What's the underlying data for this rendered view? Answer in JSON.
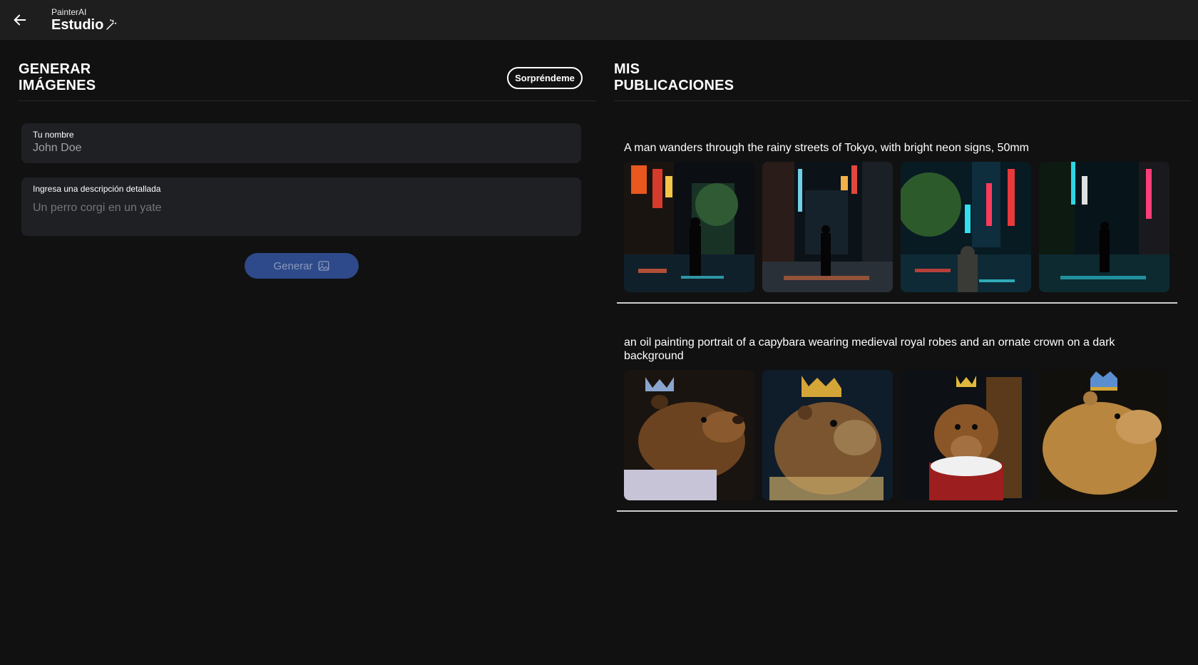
{
  "header": {
    "brand_sub": "PainterAI",
    "brand_title": "Estudio",
    "back_icon": "arrow-left-icon",
    "wand_icon": "magic-wand-icon"
  },
  "generate": {
    "title": "GENERAR IMÁGENES",
    "surprise_label": "Sorpréndeme",
    "name_label": "Tu nombre",
    "name_value": "John Doe",
    "desc_label": "Ingresa una descripción detallada",
    "desc_placeholder": "Un perro corgi en un yate",
    "generate_label": "Generar",
    "generate_icon": "image-icon"
  },
  "publications": {
    "title": "MIS PUBLICACIONES",
    "items": [
      {
        "prompt": "A man wanders through the rainy streets of Tokyo, with bright neon signs, 50mm",
        "images": [
          "tokyo-street-1",
          "tokyo-street-2",
          "tokyo-street-3",
          "tokyo-street-4"
        ]
      },
      {
        "prompt": "an oil painting portrait of a capybara wearing medieval royal robes and an ornate crown on a dark background",
        "images": [
          "capybara-king-1",
          "capybara-king-2",
          "capybara-king-3",
          "capybara-king-4"
        ]
      }
    ]
  },
  "colors": {
    "background": "#111112",
    "topbar": "#1e1e1f",
    "field": "#1f2024",
    "button": "#2e4a8a"
  }
}
